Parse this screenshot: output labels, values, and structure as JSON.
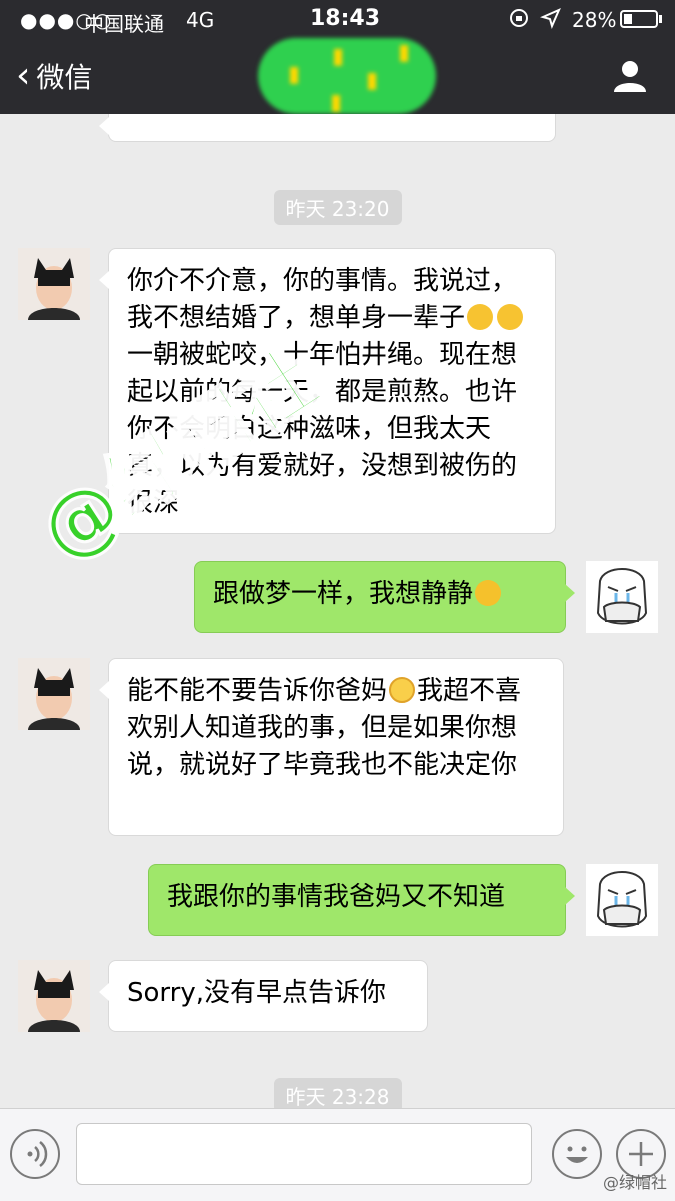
{
  "status_bar": {
    "signal": "●●●○○",
    "carrier": "中国联通",
    "network": "4G",
    "time": "18:43",
    "battery_percent": "28%",
    "battery_level": 0.28
  },
  "nav": {
    "back_label": "微信"
  },
  "chat": {
    "timestamps": [
      "昨天 23:20",
      "昨天 23:28"
    ],
    "messages": [
      {
        "side": "in",
        "text_a": "你介不介意，你的事情。我说过，我不想结婚了，想单身一辈子",
        "text_b": "一朝被蛇咬，十年怕井绳。现在想起以前的每一天，都是煎熬。也许你不会明白这种滋味，但我太天真，以为有爱就好，没想到被伤的很深"
      },
      {
        "side": "out",
        "text": "跟做梦一样，我想静静"
      },
      {
        "side": "in",
        "text_a": "能不能不要告诉你爸妈",
        "text_b": "我超不喜欢别人知道我的事，但是如果你想说，就说好了毕竟我也不能决定你"
      },
      {
        "side": "out",
        "text": "我跟你的事情我爸妈又不知道"
      },
      {
        "side": "in",
        "text": "Sorry,没有早点告诉你"
      }
    ]
  },
  "watermark": "@绿帽社",
  "credit": "@绿帽社",
  "icons": [
    "back-chevron-icon",
    "user-icon",
    "voice-icon",
    "emoji-icon",
    "plus-icon"
  ]
}
